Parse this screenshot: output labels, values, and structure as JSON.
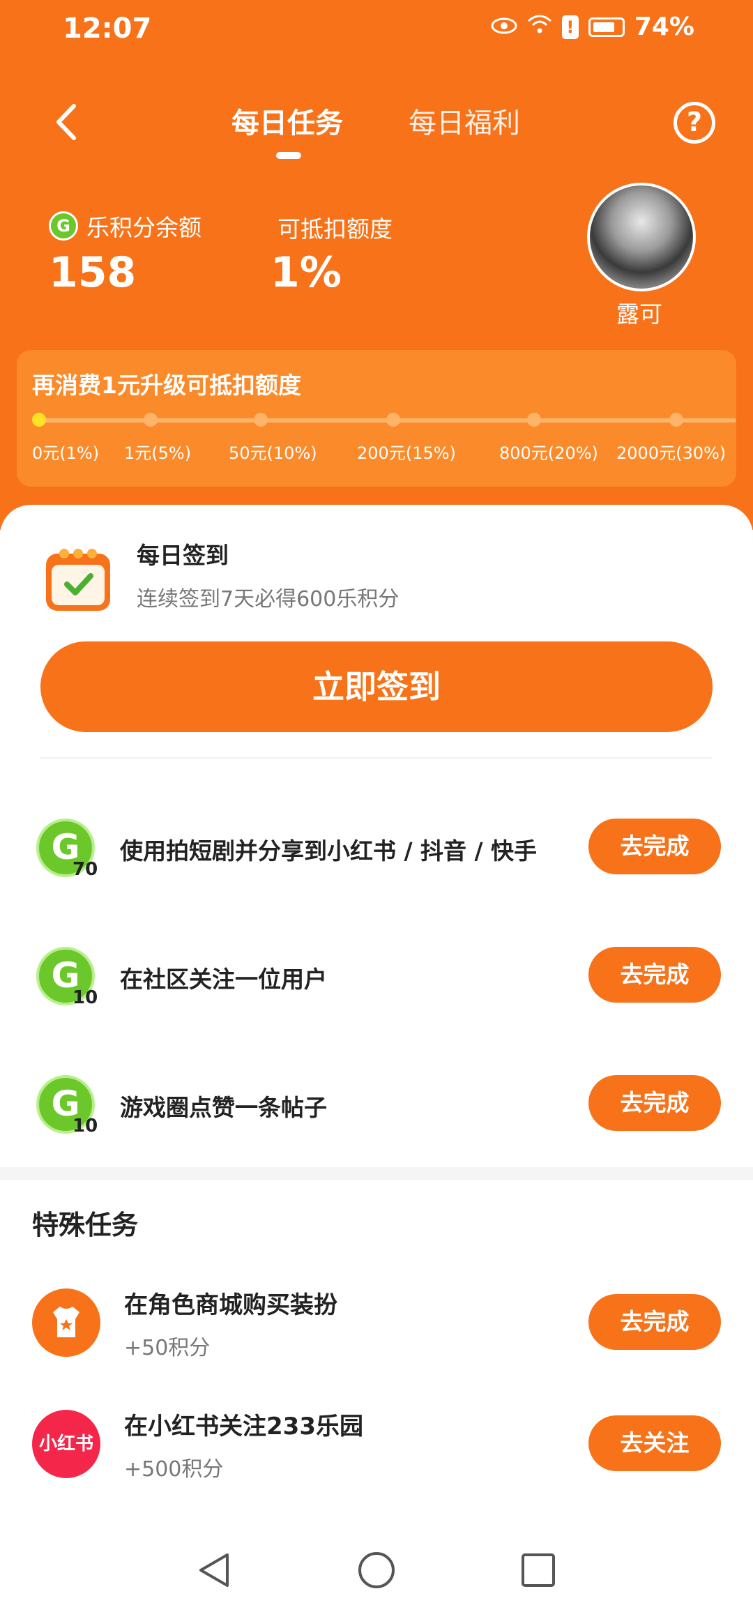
{
  "status_bar": {
    "time": "12:07",
    "battery": "74%"
  },
  "nav": {
    "tabs": [
      {
        "label": "每日任务",
        "active": true
      },
      {
        "label": "每日福利",
        "active": false
      }
    ],
    "help_symbol": "?"
  },
  "profile": {
    "balance_label": "乐积分余额",
    "balance_value": "158",
    "deduct_label": "可抵扣额度",
    "deduct_value": "1%",
    "username": "露可"
  },
  "upgrade": {
    "title": "再消费1元升级可抵扣额度",
    "ticks": [
      "0元(1%)",
      "1元(5%)",
      "50元(10%)",
      "200元(15%)",
      "800元(20%)",
      "2000元(30%)"
    ],
    "current_index": 0
  },
  "checkin": {
    "title": "每日签到",
    "subtitle": "连续签到7天必得600乐积分",
    "button": "立即签到"
  },
  "daily_tasks": [
    {
      "label": "使用拍短剧并分享到小红书 / 抖音 / 快手",
      "points": "70",
      "button": "去完成"
    },
    {
      "label": "在社区关注一位用户",
      "points": "10",
      "button": "去完成"
    },
    {
      "label": "游戏圈点赞一条帖子",
      "points": "10",
      "button": "去完成"
    }
  ],
  "special": {
    "title": "特殊任务",
    "tasks": [
      {
        "label": "在角色商城购买装扮",
        "points": "+50积分",
        "button": "去完成",
        "icon": "shirt-icon"
      },
      {
        "label": "在小红书关注233乐园",
        "points": "+500积分",
        "button": "去关注",
        "icon": "xiaohongshu-icon",
        "icon_text": "小红书"
      }
    ]
  },
  "colors": {
    "brand_orange": "#f77218",
    "coin_green": "#6cc82a",
    "xiaohongshu_red": "#f4264a"
  }
}
